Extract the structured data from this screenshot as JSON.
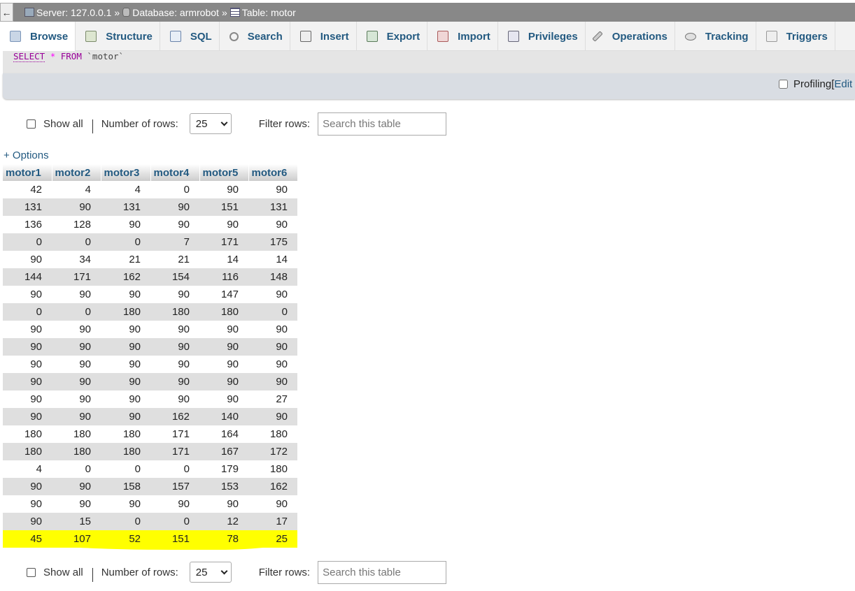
{
  "breadcrumb": {
    "back": "←",
    "server": "Server: 127.0.0.1",
    "database": "Database: armrobot",
    "table": "Table: motor",
    "sep": "»"
  },
  "tabs": [
    "Browse",
    "Structure",
    "SQL",
    "Search",
    "Insert",
    "Export",
    "Import",
    "Privileges",
    "Operations",
    "Tracking",
    "Triggers"
  ],
  "sql": {
    "select": "SELECT",
    "star": "*",
    "from": "FROM",
    "table": "`motor`"
  },
  "profiling": {
    "label": "Profiling",
    "bracket": "[",
    "edit": "Edit"
  },
  "nav": {
    "show_all": "Show all",
    "rows_label": "Number of rows:",
    "rows_value": "25",
    "filter_label": "Filter rows:",
    "search_placeholder": "Search this table"
  },
  "options": "+ Options",
  "table": {
    "columns": [
      "motor1",
      "motor2",
      "motor3",
      "motor4",
      "motor5",
      "motor6"
    ],
    "rows": [
      [
        42,
        4,
        4,
        0,
        90,
        90
      ],
      [
        131,
        90,
        131,
        90,
        151,
        131
      ],
      [
        136,
        128,
        90,
        90,
        90,
        90
      ],
      [
        0,
        0,
        0,
        7,
        171,
        175
      ],
      [
        90,
        34,
        21,
        21,
        14,
        14
      ],
      [
        144,
        171,
        162,
        154,
        116,
        148
      ],
      [
        90,
        90,
        90,
        90,
        147,
        90
      ],
      [
        0,
        0,
        180,
        180,
        180,
        0
      ],
      [
        90,
        90,
        90,
        90,
        90,
        90
      ],
      [
        90,
        90,
        90,
        90,
        90,
        90
      ],
      [
        90,
        90,
        90,
        90,
        90,
        90
      ],
      [
        90,
        90,
        90,
        90,
        90,
        90
      ],
      [
        90,
        90,
        90,
        90,
        90,
        27
      ],
      [
        90,
        90,
        90,
        162,
        140,
        90
      ],
      [
        180,
        180,
        180,
        171,
        164,
        180
      ],
      [
        180,
        180,
        180,
        171,
        167,
        172
      ],
      [
        4,
        0,
        0,
        0,
        179,
        180
      ],
      [
        90,
        90,
        158,
        157,
        153,
        162
      ],
      [
        90,
        90,
        90,
        90,
        90,
        90
      ],
      [
        90,
        15,
        0,
        0,
        12,
        17
      ],
      [
        45,
        107,
        52,
        151,
        78,
        25
      ]
    ],
    "highlighted_row": 20
  },
  "colors": {
    "link": "#235a81",
    "highlight": "#ffff00",
    "stripe": "#dfdfdf"
  }
}
